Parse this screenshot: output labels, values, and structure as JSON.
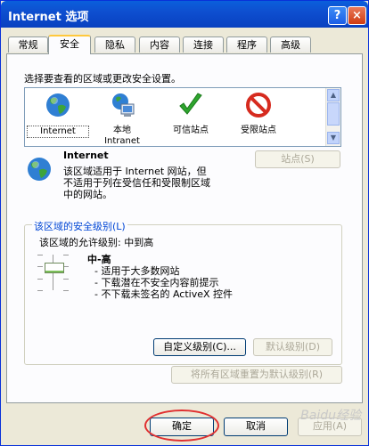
{
  "window": {
    "title": "Internet 选项",
    "help_glyph": "?",
    "close_glyph": "×"
  },
  "tabs": [
    "常规",
    "安全",
    "隐私",
    "内容",
    "连接",
    "程序",
    "高级"
  ],
  "active_tab": "安全",
  "security": {
    "instruction": "选择要查看的区域或更改安全设置。",
    "zones": [
      {
        "label": "Internet",
        "icon": "globe-icon"
      },
      {
        "label": "本地\nIntranet",
        "icon": "computer-globe-icon"
      },
      {
        "label": "可信站点",
        "icon": "green-check-icon"
      },
      {
        "label": "受限站点",
        "icon": "prohibited-icon"
      }
    ],
    "selected_zone": {
      "name": "Internet",
      "description": "该区域适用于 Internet 网站，但\n不适用于列在受信任和受限制区域\n中的网站。"
    },
    "sites_button": "站点(S)"
  },
  "level_group": {
    "title": "该区域的安全级别(L)",
    "allowed_level": "该区域的允许级别: 中到高",
    "level_name": "中-高",
    "bullets": [
      "- 适用于大多数网站",
      "- 下载潜在不安全内容前提示",
      "- 不下载未签名的 ActiveX 控件"
    ],
    "custom_button": "自定义级别(C)...",
    "default_button": "默认级别(D)"
  },
  "reset_all_button": "将所有区域重置为默认级别(R)",
  "dialog_buttons": {
    "ok": "确定",
    "cancel": "取消",
    "apply": "应用(A)"
  },
  "watermark": "Baidu经验",
  "colors": {
    "accent_highlight": "#e03030",
    "title_blue": "#0a5fdc"
  }
}
